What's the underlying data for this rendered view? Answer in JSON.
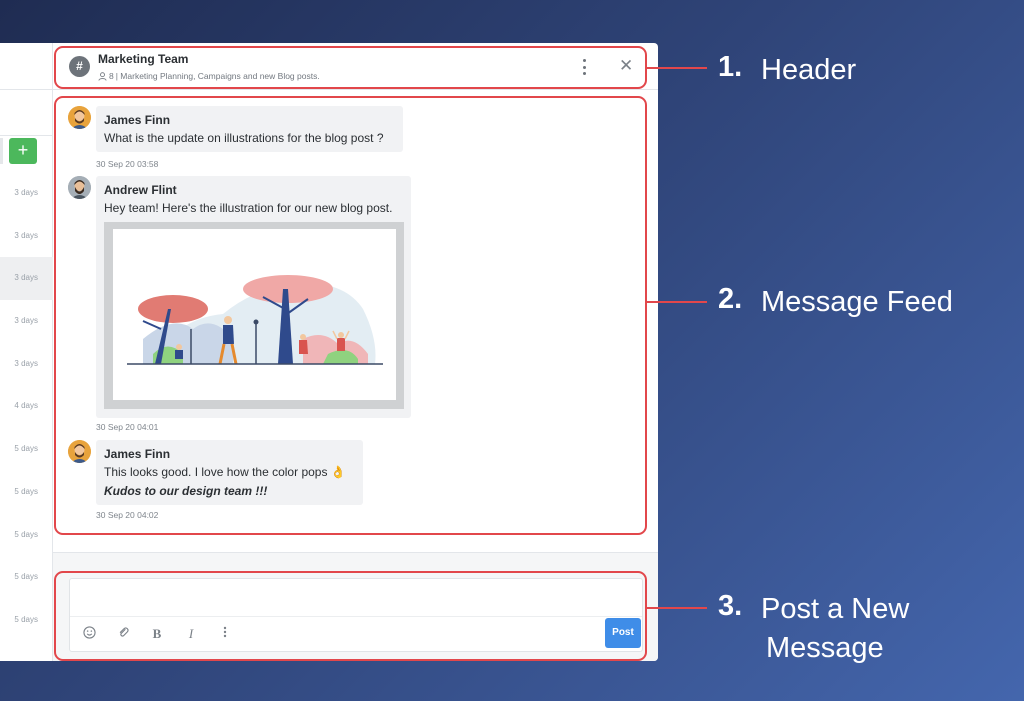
{
  "header": {
    "channel_icon": "hash-icon",
    "title": "Marketing Team",
    "member_count": "8",
    "description": "| Marketing Planning, Campaigns and new Blog posts."
  },
  "sidebar": {
    "add_label": "+",
    "times": [
      "3 days",
      "3 days",
      "3 days",
      "3 days",
      "3 days",
      "4 days",
      "5 days",
      "5 days",
      "5 days",
      "5 days",
      "5 days"
    ]
  },
  "messages": [
    {
      "sender": "James Finn",
      "text": "What is the update on illustrations for the blog post ?",
      "time": "30 Sep 20 03:58"
    },
    {
      "sender": "Andrew Flint",
      "text": "Hey team! Here's the illustration for our new blog post.",
      "time": "30 Sep 20 04:01"
    },
    {
      "sender": "James Finn",
      "text": "This looks good. I love how the color pops 👌",
      "text2": "Kudos to our design team !!!",
      "time": "30 Sep 20 04:02"
    }
  ],
  "composer": {
    "post_label": "Post",
    "tools": [
      "emoji-icon",
      "attachment-icon",
      "bold-icon",
      "italic-icon",
      "more-icon"
    ]
  },
  "callouts": [
    {
      "num": "1.",
      "label": "Header"
    },
    {
      "num": "2.",
      "label": "Message Feed"
    },
    {
      "num": "3.",
      "label_line1": "Post a New",
      "label_line2": "Message"
    }
  ],
  "colors": {
    "accent": "#e2474b",
    "post_button": "#3f8de8",
    "add_button": "#4cb85c"
  }
}
